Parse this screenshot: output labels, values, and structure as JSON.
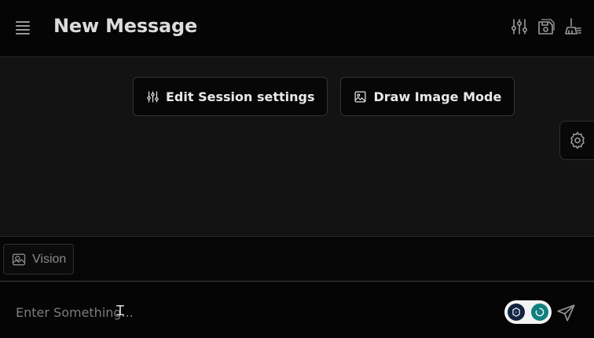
{
  "header": {
    "title": "New Message",
    "icons": [
      "menu-icon",
      "sliders-icon",
      "save-icon",
      "broom-icon"
    ]
  },
  "main": {
    "buttons": [
      {
        "label": "Edit Session settings",
        "icon": "sliders-icon"
      },
      {
        "label": "Draw Image Mode",
        "icon": "image-icon"
      }
    ],
    "side_tab_icon": "gear-icon"
  },
  "vision": {
    "label": "Vision",
    "icon": "image-vision-icon"
  },
  "composer": {
    "placeholder": "Enter Something...",
    "value": "",
    "send_icon": "send-icon"
  },
  "colors": {
    "background": "#131313",
    "header": "#050505",
    "accent_teal": "#127f80",
    "badge_navy": "#12233f"
  }
}
